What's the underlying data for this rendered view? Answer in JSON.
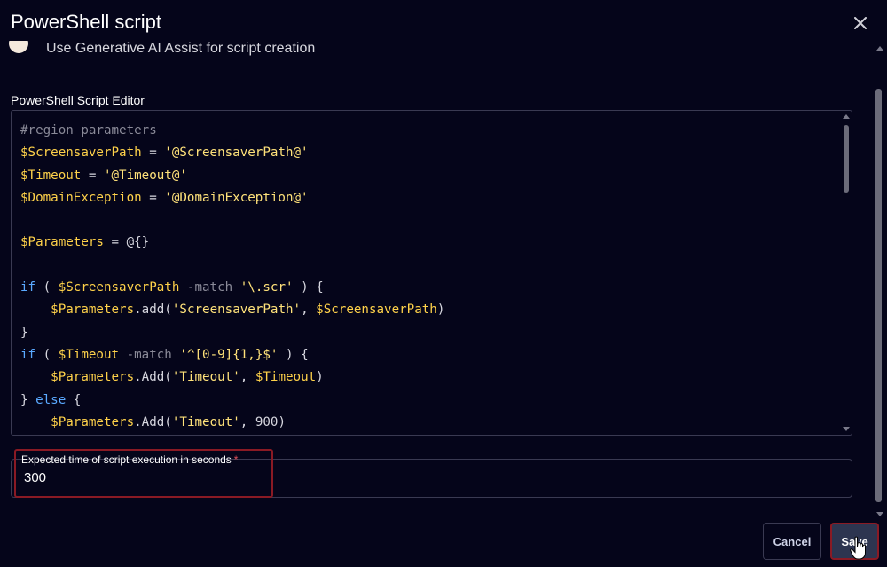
{
  "dialog": {
    "title": "PowerShell script",
    "close_icon": "close-icon"
  },
  "toggle": {
    "label": "Use Generative AI Assist for script creation"
  },
  "editor": {
    "label": "PowerShell Script Editor",
    "lines": [
      [
        {
          "t": "#region parameters",
          "c": "c"
        }
      ],
      [
        {
          "t": "$ScreensaverPath",
          "c": "v"
        },
        {
          "t": " = ",
          "c": "o"
        },
        {
          "t": "'@ScreensaverPath@'",
          "c": "s"
        }
      ],
      [
        {
          "t": "$Timeout",
          "c": "v"
        },
        {
          "t": " = ",
          "c": "o"
        },
        {
          "t": "'@Timeout@'",
          "c": "s"
        }
      ],
      [
        {
          "t": "$DomainException",
          "c": "v"
        },
        {
          "t": " = ",
          "c": "o"
        },
        {
          "t": "'@DomainException@'",
          "c": "s"
        }
      ],
      [],
      [
        {
          "t": "$Parameters",
          "c": "v"
        },
        {
          "t": " = @{}",
          "c": "o"
        }
      ],
      [],
      [
        {
          "t": "if",
          "c": "k"
        },
        {
          "t": " ( ",
          "c": "o"
        },
        {
          "t": "$ScreensaverPath",
          "c": "v"
        },
        {
          "t": " -match ",
          "c": "c"
        },
        {
          "t": "'\\.scr'",
          "c": "s"
        },
        {
          "t": " ) {",
          "c": "o"
        }
      ],
      [
        {
          "t": "    ",
          "c": "o"
        },
        {
          "t": "$Parameters",
          "c": "v"
        },
        {
          "t": ".add(",
          "c": "o"
        },
        {
          "t": "'ScreensaverPath'",
          "c": "s"
        },
        {
          "t": ", ",
          "c": "o"
        },
        {
          "t": "$ScreensaverPath",
          "c": "v"
        },
        {
          "t": ")",
          "c": "o"
        }
      ],
      [
        {
          "t": "}",
          "c": "o"
        }
      ],
      [
        {
          "t": "if",
          "c": "k"
        },
        {
          "t": " ( ",
          "c": "o"
        },
        {
          "t": "$Timeout",
          "c": "v"
        },
        {
          "t": " -match ",
          "c": "c"
        },
        {
          "t": "'^[0-9]{1,}$'",
          "c": "s"
        },
        {
          "t": " ) {",
          "c": "o"
        }
      ],
      [
        {
          "t": "    ",
          "c": "o"
        },
        {
          "t": "$Parameters",
          "c": "v"
        },
        {
          "t": ".Add(",
          "c": "o"
        },
        {
          "t": "'Timeout'",
          "c": "s"
        },
        {
          "t": ", ",
          "c": "o"
        },
        {
          "t": "$Timeout",
          "c": "v"
        },
        {
          "t": ")",
          "c": "o"
        }
      ],
      [
        {
          "t": "} ",
          "c": "o"
        },
        {
          "t": "else",
          "c": "k"
        },
        {
          "t": " {",
          "c": "o"
        }
      ],
      [
        {
          "t": "    ",
          "c": "o"
        },
        {
          "t": "$Parameters",
          "c": "v"
        },
        {
          "t": ".Add(",
          "c": "o"
        },
        {
          "t": "'Timeout'",
          "c": "s"
        },
        {
          "t": ", 900)",
          "c": "o"
        }
      ]
    ]
  },
  "execution_field": {
    "label": "Expected time of script execution in seconds",
    "required_mark": "*",
    "value": "300"
  },
  "buttons": {
    "cancel": "Cancel",
    "save": "Save"
  },
  "colors": {
    "background": "#05051a",
    "variable": "#ffd24a",
    "string": "#ffe27a",
    "keyword": "#5aa9ff",
    "comment": "#8a8a98",
    "highlight_border": "#8a1a24",
    "save_bg": "#2d3550"
  }
}
